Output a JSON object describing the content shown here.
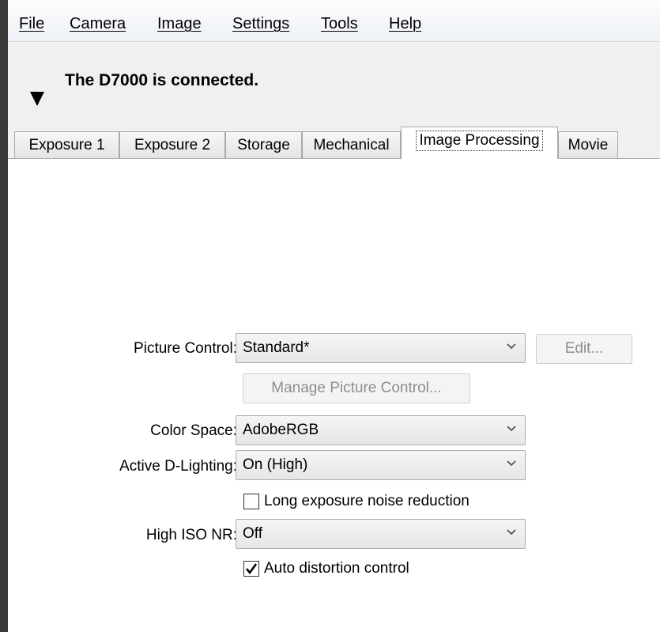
{
  "menu": {
    "items": [
      {
        "label": "File"
      },
      {
        "label": "Camera"
      },
      {
        "label": "Image"
      },
      {
        "label": "Settings"
      },
      {
        "label": "Tools"
      },
      {
        "label": "Help"
      }
    ]
  },
  "status": {
    "text": "The D7000 is connected.",
    "toggle_icon": "triangle-down-icon"
  },
  "tabs": [
    {
      "label": "Exposure 1"
    },
    {
      "label": "Exposure 2"
    },
    {
      "label": "Storage"
    },
    {
      "label": "Mechanical"
    },
    {
      "label": "Image Processing",
      "active": true
    },
    {
      "label": "Movie"
    }
  ],
  "form": {
    "picture_control": {
      "label": "Picture Control:",
      "value": "Standard*"
    },
    "edit_button": {
      "label": "Edit...",
      "enabled": false
    },
    "manage_button": {
      "label": "Manage Picture Control...",
      "enabled": false
    },
    "color_space": {
      "label": "Color Space:",
      "value": "AdobeRGB"
    },
    "active_d_lighting": {
      "label": "Active D-Lighting:",
      "value": "On (High)"
    },
    "long_exposure_nr": {
      "label": "Long exposure noise reduction",
      "checked": false
    },
    "high_iso_nr": {
      "label": "High ISO NR:",
      "value": "Off"
    },
    "auto_distortion": {
      "label": "Auto distortion control",
      "checked": true
    }
  },
  "colors": {
    "window_bg": "#f0f0f0",
    "panel_bg": "#ffffff",
    "disabled_text": "#8d8d8d",
    "outer_bg": "#3a3a3a"
  }
}
